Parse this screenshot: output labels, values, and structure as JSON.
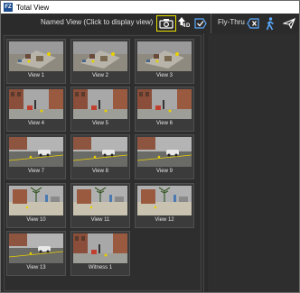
{
  "window": {
    "title": "Total View",
    "app_icon": "fz-app-icon"
  },
  "toolbar": {
    "named_view_label": "Named View (Click to display view)",
    "flythru_label": "Fly-Thru",
    "views_count_badge": "4",
    "views_count_suffix": "D",
    "icons": {
      "camera": "camera-icon",
      "views": "arrow-up-icon",
      "check": "check-tag-icon",
      "clear": "clear-x-icon",
      "walk": "walking-person-icon",
      "fly": "paper-plane-icon"
    },
    "accent_color": "#e8e000"
  },
  "views": [
    {
      "label": "View 1",
      "scene": "plaza"
    },
    {
      "label": "View 2",
      "scene": "plaza"
    },
    {
      "label": "View 3",
      "scene": "plaza"
    },
    {
      "label": "View 4",
      "scene": "street"
    },
    {
      "label": "View 5",
      "scene": "street"
    },
    {
      "label": "View 6",
      "scene": "street"
    },
    {
      "label": "View 7",
      "scene": "road"
    },
    {
      "label": "View 8",
      "scene": "road"
    },
    {
      "label": "View 9",
      "scene": "road"
    },
    {
      "label": "View 10",
      "scene": "trees"
    },
    {
      "label": "View 11",
      "scene": "trees"
    },
    {
      "label": "View 12",
      "scene": "trees"
    },
    {
      "label": "View 13",
      "scene": "road"
    },
    {
      "label": "Witness 1",
      "scene": "street"
    }
  ]
}
